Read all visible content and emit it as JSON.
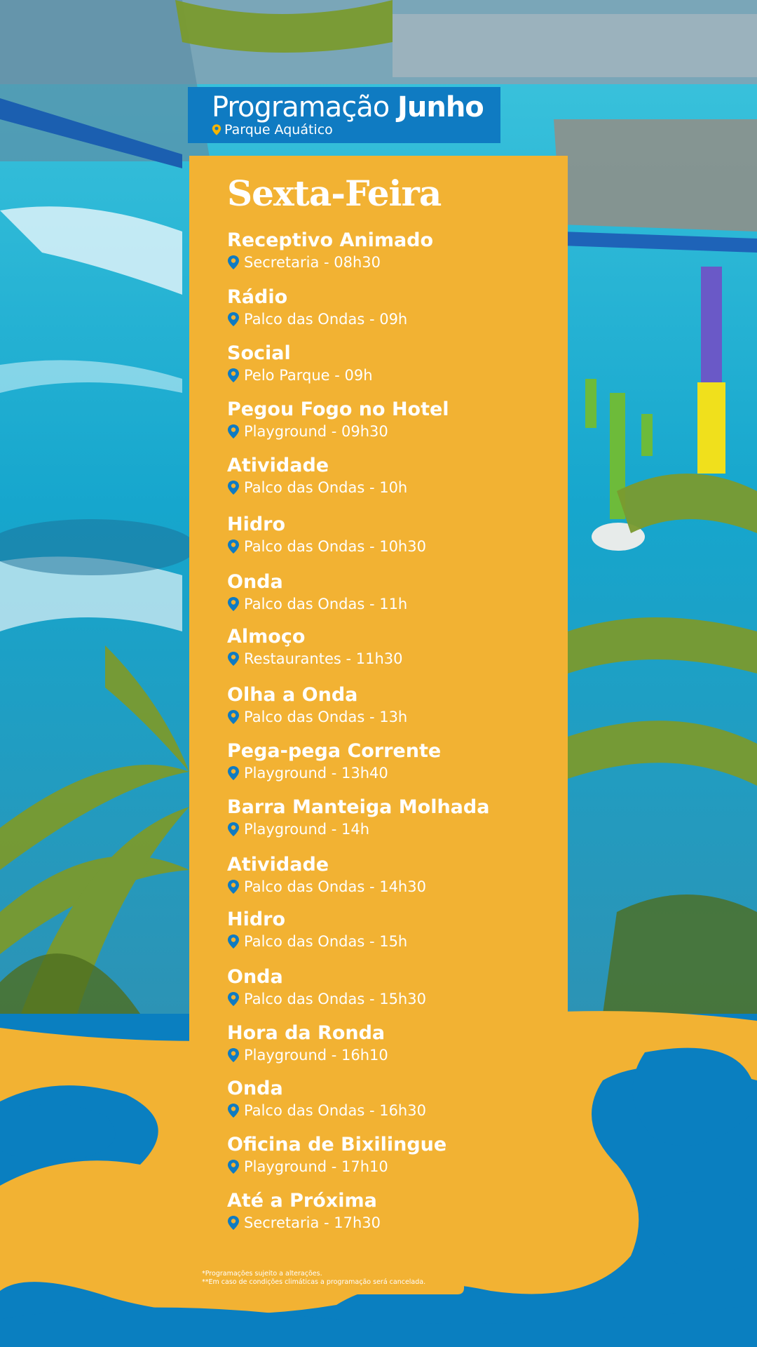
{
  "header": {
    "title_regular": "Programação",
    "title_bold": "Junho",
    "subtitle": "Parque Aquático"
  },
  "day": "Sexta-Feira",
  "events": [
    {
      "name": "Receptivo Animado",
      "location": "Secretaria - 08h30"
    },
    {
      "name": "Rádio",
      "location": "Palco das Ondas - 09h"
    },
    {
      "name": "Social",
      "location": "Pelo Parque - 09h"
    },
    {
      "name": "Pegou Fogo no Hotel",
      "location": "Playground  - 09h30"
    },
    {
      "name": "Atividade",
      "location": "Palco das Ondas - 10h"
    },
    {
      "name": "Hidro",
      "location": "Palco das Ondas - 10h30"
    },
    {
      "name": "Onda",
      "location": "Palco das Ondas - 11h"
    },
    {
      "name": "Almoço",
      "location": "Restaurantes - 11h30"
    },
    {
      "name": "Olha a Onda",
      "location": "Palco das Ondas - 13h"
    },
    {
      "name": "Pega-pega Corrente",
      "location": "Playground - 13h40"
    },
    {
      "name": "Barra Manteiga Molhada",
      "location": "Playground - 14h"
    },
    {
      "name": "Atividade",
      "location": "Palco das Ondas - 14h30"
    },
    {
      "name": "Hidro",
      "location": "Palco das Ondas  - 15h"
    },
    {
      "name": "Onda",
      "location": "Palco das Ondas - 15h30"
    },
    {
      "name": "Hora da Ronda",
      "location": "Playground - 16h10"
    },
    {
      "name": "Onda",
      "location": "Palco das Ondas - 16h30"
    },
    {
      "name": "Oficina de Bixilingue",
      "location": "Playground - 17h10"
    },
    {
      "name": "Até a Próxima",
      "location": "Secretaria - 17h30"
    }
  ],
  "footnotes": [
    "*Programações sujeito a alterações.",
    "**Em caso de condições climáticas a programação será cancelada."
  ],
  "colors": {
    "brand_blue": "#0f7bc2",
    "panel_yellow": "#f2b233",
    "pin_yellow": "#f5b400"
  },
  "icons": {
    "location": "map-pin-icon"
  }
}
